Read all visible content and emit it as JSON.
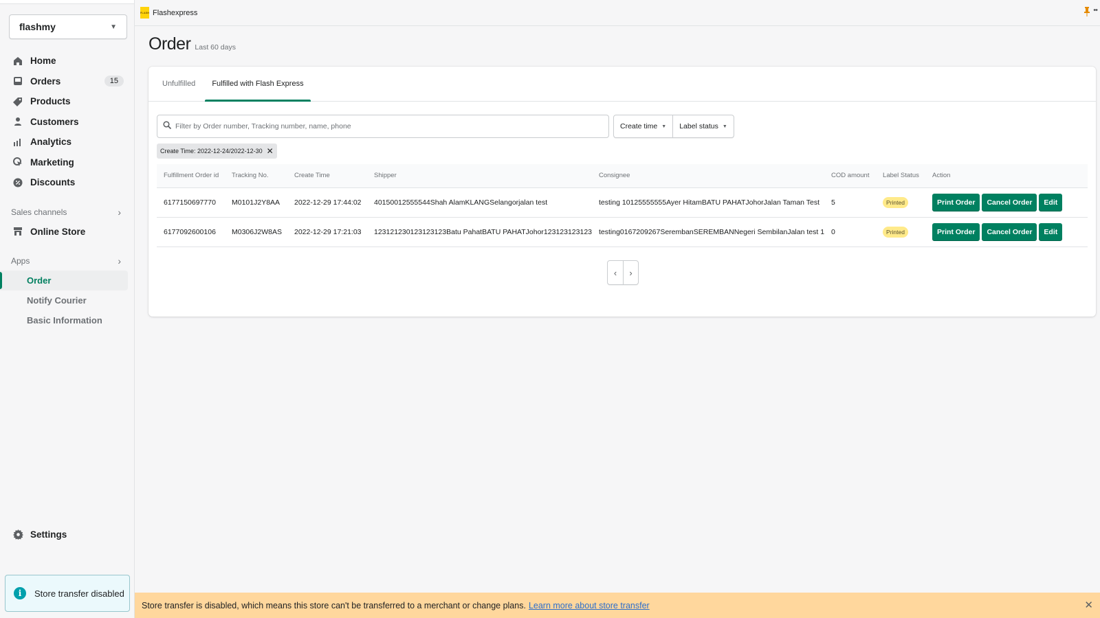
{
  "topbar": {
    "app_name": "Flashexpress",
    "logo_text": "FLASH"
  },
  "sidebar": {
    "store_name": "flashmy",
    "nav": [
      {
        "label": "Home",
        "icon": "home-icon"
      },
      {
        "label": "Orders",
        "icon": "orders-icon",
        "badge": "15"
      },
      {
        "label": "Products",
        "icon": "tag-icon"
      },
      {
        "label": "Customers",
        "icon": "person-icon"
      },
      {
        "label": "Analytics",
        "icon": "bar-chart-icon"
      },
      {
        "label": "Marketing",
        "icon": "marketing-icon"
      },
      {
        "label": "Discounts",
        "icon": "discount-icon"
      }
    ],
    "sales_channels_label": "Sales channels",
    "online_store_label": "Online Store",
    "apps_label": "Apps",
    "app_items": [
      {
        "label": "Order",
        "active": true
      },
      {
        "label": "Notify Courier",
        "active": false
      },
      {
        "label": "Basic Information",
        "active": false
      }
    ],
    "settings_label": "Settings",
    "transfer_notice": "Store transfer disabled"
  },
  "page": {
    "title": "Order",
    "subtitle": "Last 60 days"
  },
  "tabs": [
    {
      "label": "Unfulfilled",
      "active": false
    },
    {
      "label": "Fulfilled with Flash Express",
      "active": true
    }
  ],
  "filters": {
    "search_placeholder": "Filter by Order number, Tracking number, name, phone",
    "search_value": "",
    "create_time_label": "Create time",
    "label_status_label": "Label status",
    "applied_chip": "Create Time: 2022-12-24/2022-12-30"
  },
  "table": {
    "columns": [
      "Fulfillment Order id",
      "Tracking No.",
      "Create Time",
      "Shipper",
      "Consignee",
      "COD amount",
      "Label Status",
      "Action"
    ],
    "rows": [
      {
        "order_id": "6177150697770",
        "tracking": "M0101J2Y8AA",
        "create_time": "2022-12-29 17:44:02",
        "shipper": "40150012555544Shah AlamKLANGSelangorjalan test",
        "consignee": "testing 10125555555Ayer HitamBATU PAHATJohorJalan Taman Test",
        "cod": "5",
        "status": "Printed"
      },
      {
        "order_id": "6177092600106",
        "tracking": "M0306J2W8AS",
        "create_time": "2022-12-29 17:21:03",
        "shipper": "123121230123123123Batu PahatBATU PAHATJohor123123123123",
        "consignee": "testing0167209267SerembanSEREMBANNegeri SembilanJalan test 1",
        "cod": "0",
        "status": "Printed"
      }
    ],
    "actions": {
      "print": "Print Order",
      "cancel": "Cancel Order",
      "edit": "Edit"
    }
  },
  "pagination": {
    "prev": "‹",
    "next": "›"
  },
  "banner": {
    "text": "Store transfer is disabled, which means this store can't be transferred to a merchant or change plans.",
    "link": "Learn more about store transfer",
    "close": "✕"
  },
  "colors": {
    "accent": "#008060",
    "status_badge": "#ffea8a",
    "banner_bg": "#ffd79d",
    "info_box_bg": "#ebf9fc"
  }
}
